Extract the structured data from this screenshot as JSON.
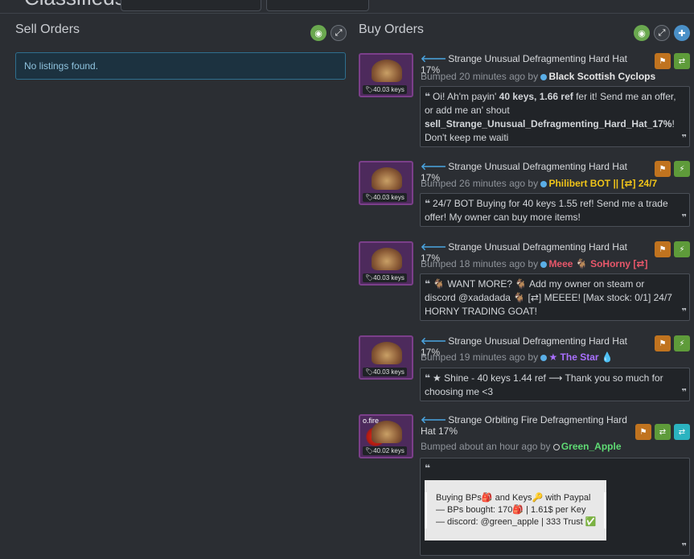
{
  "header": {
    "site": "Classifieds"
  },
  "sell": {
    "title": "Sell Orders",
    "empty": "No listings found."
  },
  "buy": {
    "title": "Buy Orders"
  },
  "colors": {
    "strange_unusual": "#7b3f8a",
    "accent": "#4aa3df",
    "green_btn": "#6aa84f"
  },
  "listings": [
    {
      "title": "Strange Unusual Defragmenting Hard Hat 17%",
      "price": "40.03 keys",
      "bumped": "Bumped 20 minutes ago by",
      "user": "Black Scottish Cyclops",
      "msg_a": "Oi! Ah'm payin' ",
      "msg_b": "40 keys, 1.66 ref",
      "msg_c": " fer it! Send me an offer, or add me an' shout ",
      "msg_d": "sell_Strange_Unusual_Defragmenting_Hard_Hat_17%",
      "msg_e": "! Don't keep me waiti"
    },
    {
      "title": "Strange Unusual Defragmenting Hard Hat 17%",
      "price": "40.03 keys",
      "bumped": "Bumped 26 minutes ago by",
      "user": "Philibert BOT || [⇄] 24/7",
      "msg": "24/7 BOT Buying for 40 keys 1.55 ref! Send me a trade offer! My owner can buy more items!"
    },
    {
      "title": "Strange Unusual Defragmenting Hard Hat 17%",
      "price": "40.03 keys",
      "bumped": "Bumped 18 minutes ago by",
      "user": "Meee 🐐 SoHorny [⇄]",
      "msg": "🐐 WANT MORE? 🐐 Add my owner on steam or discord @xadadada 🐐 [⇄] MEEEE! [Max stock: 0/1] 24/7 HORNY TRADING GOAT!"
    },
    {
      "title": "Strange Unusual Defragmenting Hard Hat 17%",
      "price": "40.03 keys",
      "bumped": "Bumped 19 minutes ago by",
      "user": "★ The Star 💧",
      "msg": "★ Shine - 40 keys 1.44 ref ⟶ Thank you so much for choosing me <3"
    },
    {
      "title": "Strange Orbiting Fire Defragmenting Hard Hat 17%",
      "price": "40.02 keys",
      "effect_tag": "o.fire",
      "bumped": "Bumped about an hour ago by",
      "user": "Green_Apple",
      "lines": [
        "Buying BPs🎒 and Keys🔑 with Paypal",
        "— BPs bought: 170🎒 | 1.61$ per Key",
        "— discord: @green_apple | 333 Trust ✅"
      ]
    }
  ]
}
